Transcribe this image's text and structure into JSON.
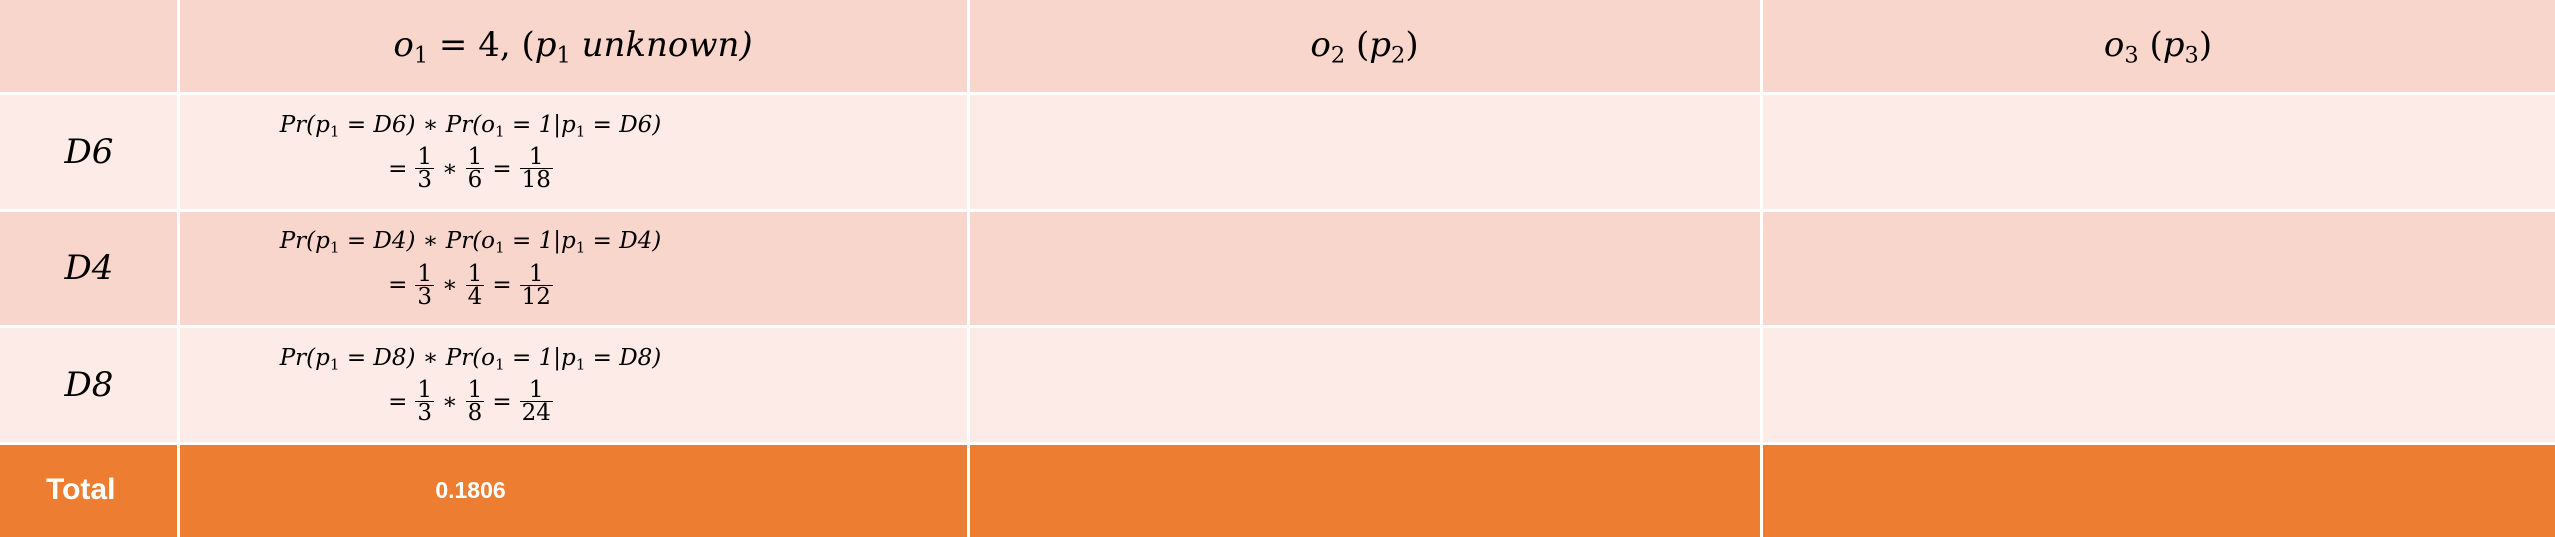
{
  "header": {
    "col1": {
      "base": "o",
      "sub": "1",
      "rest": " = 4, (",
      "p": "p",
      "psub": "1",
      "tail": " unknown)"
    },
    "col2": {
      "base": "o",
      "sub": "2",
      "mid": " (",
      "p": "p",
      "psub": "2",
      "tail": ")"
    },
    "col3": {
      "base": "o",
      "sub": "3",
      "mid": " (",
      "p": "p",
      "psub": "3",
      "tail": ")"
    }
  },
  "rows": [
    {
      "label": "D6",
      "formula": {
        "line1_a": "Pr(p",
        "sub1": "1",
        "line1_b": " = D6) ∗ Pr(o",
        "sub2": "1",
        "line1_c": " = 1|p",
        "sub3": "1",
        "line1_d": " = D6)",
        "eq": "=",
        "f1n": "1",
        "f1d": "3",
        "mul": "∗",
        "f2n": "1",
        "f2d": "6",
        "eq2": "=",
        "f3n": "1",
        "f3d": "18"
      }
    },
    {
      "label": "D4",
      "formula": {
        "line1_a": "Pr(p",
        "sub1": "1",
        "line1_b": " = D4) ∗ Pr(o",
        "sub2": "1",
        "line1_c": " = 1|p",
        "sub3": "1",
        "line1_d": " = D4)",
        "eq": "=",
        "f1n": "1",
        "f1d": "3",
        "mul": "∗",
        "f2n": "1",
        "f2d": "4",
        "eq2": "=",
        "f3n": "1",
        "f3d": "12"
      }
    },
    {
      "label": "D8",
      "formula": {
        "line1_a": "Pr(p",
        "sub1": "1",
        "line1_b": " = D8) ∗ Pr(o",
        "sub2": "1",
        "line1_c": " = 1|p",
        "sub3": "1",
        "line1_d": " = D8)",
        "eq": "=",
        "f1n": "1",
        "f1d": "3",
        "mul": "∗",
        "f2n": "1",
        "f2d": "8",
        "eq2": "=",
        "f3n": "1",
        "f3d": "24"
      }
    }
  ],
  "total": {
    "label": "Total",
    "value": "0.1806"
  },
  "colors": {
    "header": "#f8d6cb",
    "row_light": "#fcebe6",
    "row_mid": "#f8d6cb",
    "total": "#ed7d31",
    "grid": "#ffffff"
  }
}
